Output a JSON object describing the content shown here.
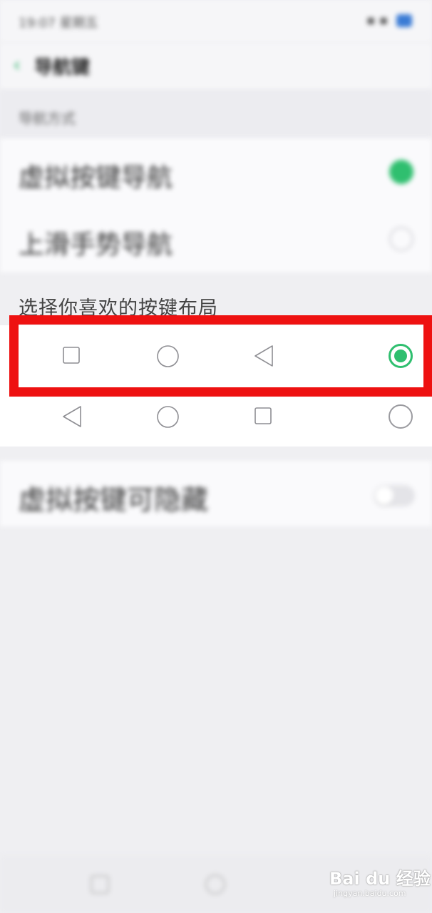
{
  "status_bar": {
    "time": "19:07 星期五",
    "icons": "▪ ▪"
  },
  "app_bar": {
    "back_icon": "chevron-left-icon",
    "title": "导航键"
  },
  "section_header": {
    "label": "导航方式"
  },
  "nav_options": [
    {
      "label": "虚拟按键导航",
      "checked": true
    },
    {
      "label": "上滑手势导航",
      "checked": false
    }
  ],
  "layout_section": {
    "label": "选择你喜欢的按键布局",
    "rows": [
      {
        "keys": [
          "square-icon",
          "circle-icon",
          "triangle-left-icon"
        ],
        "selected": true
      },
      {
        "keys": [
          "triangle-left-icon",
          "circle-icon",
          "square-icon"
        ],
        "selected": false
      }
    ]
  },
  "hide_row": {
    "label": "虚拟按键可隐藏",
    "toggle_on": false
  },
  "colors": {
    "accent": "#2fbf6f",
    "highlight": "#ee1111"
  },
  "watermark": {
    "brand": "Bai du 经验",
    "url": "jingyan.baidu.com"
  }
}
